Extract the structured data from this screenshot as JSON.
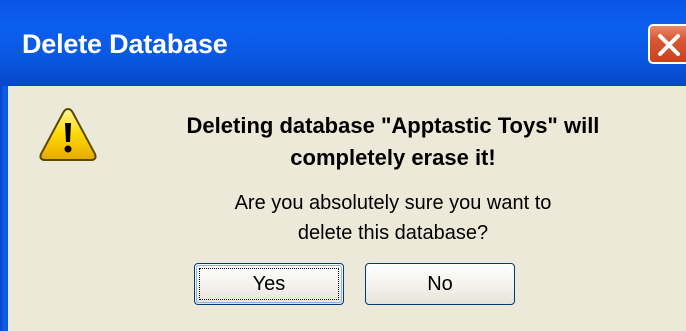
{
  "window": {
    "title": "Delete Database"
  },
  "dialog": {
    "icon": "warning-icon",
    "message_bold_line1": "Deleting database \"Apptastic Toys\" will",
    "message_bold_line2": "completely erase it!",
    "message_line1": "Are you absolutely sure you want to",
    "message_line2": "delete this database?"
  },
  "buttons": {
    "yes_label": "Yes",
    "no_label": "No"
  },
  "colors": {
    "titlebar": "#0a55e8",
    "dialog_background": "#ece9d8",
    "close_button": "#d95a36",
    "warning_yellow": "#ffd900"
  }
}
